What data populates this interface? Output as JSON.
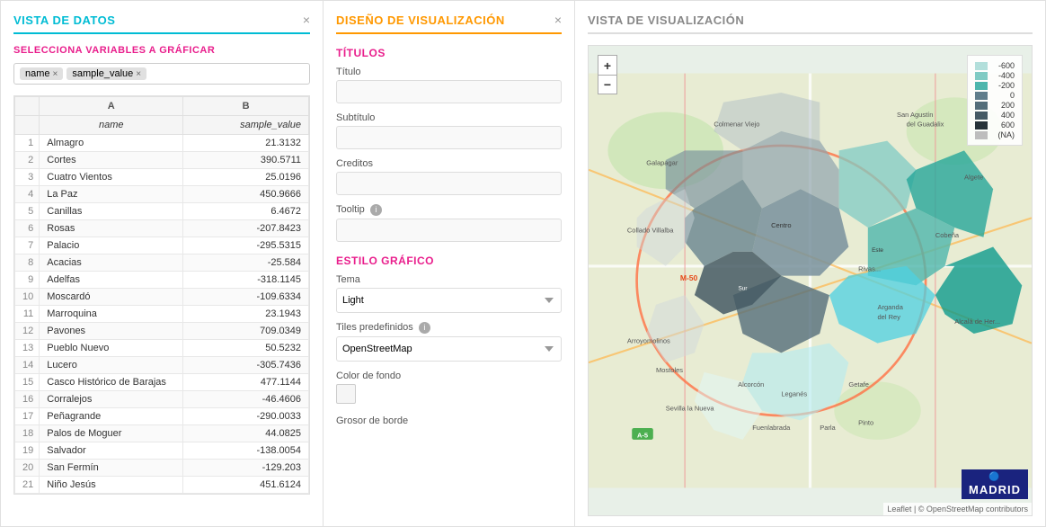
{
  "panel1": {
    "title": "VISTA DE DATOS",
    "section_label": "SELECCIONA VARIABLES A GRÁFICAR",
    "tags": [
      "name",
      "sample_value"
    ],
    "columns": {
      "col_a_header": "A",
      "col_b_header": "B",
      "col_a_name": "name",
      "col_b_name": "sample_value"
    },
    "rows": [
      {
        "num": "1",
        "name": "Almagro",
        "value": "21.3132"
      },
      {
        "num": "2",
        "name": "Cortes",
        "value": "390.5711"
      },
      {
        "num": "3",
        "name": "Cuatro Vientos",
        "value": "25.0196"
      },
      {
        "num": "4",
        "name": "La Paz",
        "value": "450.9666"
      },
      {
        "num": "5",
        "name": "Canillas",
        "value": "6.4672"
      },
      {
        "num": "6",
        "name": "Rosas",
        "value": "-207.8423"
      },
      {
        "num": "7",
        "name": "Palacio",
        "value": "-295.5315"
      },
      {
        "num": "8",
        "name": "Acacias",
        "value": "-25.584"
      },
      {
        "num": "9",
        "name": "Adelfas",
        "value": "-318.1145"
      },
      {
        "num": "10",
        "name": "Moscardó",
        "value": "-109.6334"
      },
      {
        "num": "11",
        "name": "Marroquina",
        "value": "23.1943"
      },
      {
        "num": "12",
        "name": "Pavones",
        "value": "709.0349"
      },
      {
        "num": "13",
        "name": "Pueblo Nuevo",
        "value": "50.5232"
      },
      {
        "num": "14",
        "name": "Lucero",
        "value": "-305.7436"
      },
      {
        "num": "15",
        "name": "Casco Histórico de Barajas",
        "value": "477.1144"
      },
      {
        "num": "16",
        "name": "Corralejos",
        "value": "-46.4606"
      },
      {
        "num": "17",
        "name": "Peñagrande",
        "value": "-290.0033"
      },
      {
        "num": "18",
        "name": "Palos de Moguer",
        "value": "44.0825"
      },
      {
        "num": "19",
        "name": "Salvador",
        "value": "-138.0054"
      },
      {
        "num": "20",
        "name": "San Fermín",
        "value": "-129.203"
      },
      {
        "num": "21",
        "name": "Niño Jesús",
        "value": "451.6124"
      }
    ]
  },
  "panel2": {
    "title": "DISEÑO DE VISUALIZACIÓN",
    "sections": {
      "titulos": "TÍTULOS",
      "estilo": "ESTILO GRÁFICO"
    },
    "fields": {
      "titulo_label": "Título",
      "subtitulo_label": "Subtítulo",
      "creditos_label": "Creditos",
      "tooltip_label": "Tooltip",
      "tema_label": "Tema",
      "tema_value": "Light",
      "tiles_label": "Tiles predefinidos",
      "tiles_value": "OpenStreetMap",
      "color_fondo_label": "Color de fondo",
      "grosor_borde_label": "Grosor de borde"
    }
  },
  "panel3": {
    "title": "VISTA DE VISUALIZACIÓN",
    "legend": {
      "items": [
        {
          "value": "-600",
          "color": "#e8f5e9"
        },
        {
          "value": "-400",
          "color": "#b2dfdb"
        },
        {
          "value": "-200",
          "color": "#80cbc4"
        },
        {
          "value": "0",
          "color": "#80cbc4"
        },
        {
          "value": "200",
          "color": "#546e7a"
        },
        {
          "value": "400",
          "color": "#37474f"
        },
        {
          "value": "600",
          "color": "#1a237e"
        },
        {
          "value": "NA",
          "color": "#bdbdbd"
        }
      ]
    },
    "attribution": "Leaflet | © OpenStreetMap contributors",
    "madrid_logo": "MADRID"
  },
  "icons": {
    "close": "×",
    "plus": "+",
    "minus": "−",
    "info": "i"
  }
}
